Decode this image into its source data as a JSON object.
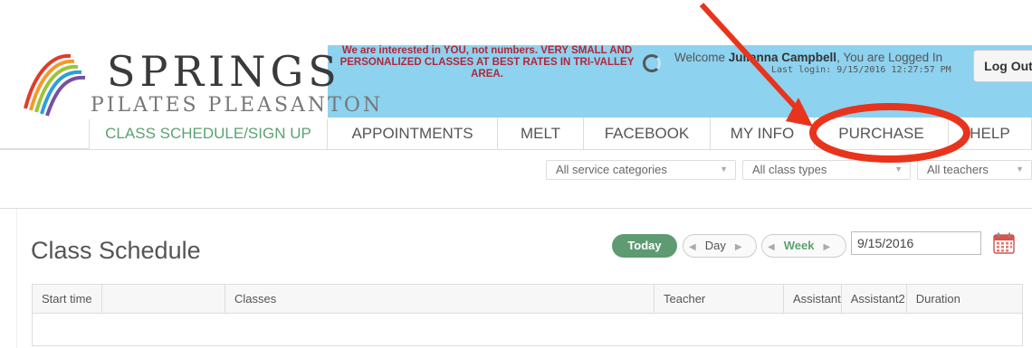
{
  "logo": {
    "name": "SPRINGS",
    "subtitle": "PILATES PLEASANTON"
  },
  "header": {
    "tagline": "We are interested in YOU, not numbers. VERY SMALL AND PERSONALIZED CLASSES AT BEST RATES IN TRI-VALLEY AREA.",
    "welcome_prefix": "Welcome ",
    "user_name": "Julianna Campbell",
    "welcome_suffix": ", You are Logged In",
    "last_login": "Last login: 9/15/2016 12:27:57 PM",
    "logout_label": "Log Out",
    "band_color": "#8dd2ef",
    "tagline_color": "#b3263a"
  },
  "tabs": [
    {
      "label": "CLASS SCHEDULE/SIGN UP",
      "active": true
    },
    {
      "label": "APPOINTMENTS"
    },
    {
      "label": "MELT"
    },
    {
      "label": "FACEBOOK"
    },
    {
      "label": "MY INFO"
    },
    {
      "label": "PURCHASE"
    },
    {
      "label": "HELP"
    }
  ],
  "filters": {
    "service_categories": "All service categories",
    "class_types": "All class types",
    "teachers": "All teachers"
  },
  "schedule": {
    "title": "Class Schedule",
    "today_label": "Today",
    "day_label": "Day",
    "week_label": "Week",
    "date_value": "9/15/2016",
    "columns": [
      "Start time",
      "",
      "Classes",
      "Teacher",
      "Assistant",
      "Assistant2",
      "Duration"
    ]
  },
  "annotation": {
    "arrow_color": "#e8341c",
    "circle_color": "#e8341c",
    "highlighted_tab": "PURCHASE"
  },
  "colors": {
    "accent_green": "#5aa36f",
    "today_button": "#5e9b72"
  }
}
